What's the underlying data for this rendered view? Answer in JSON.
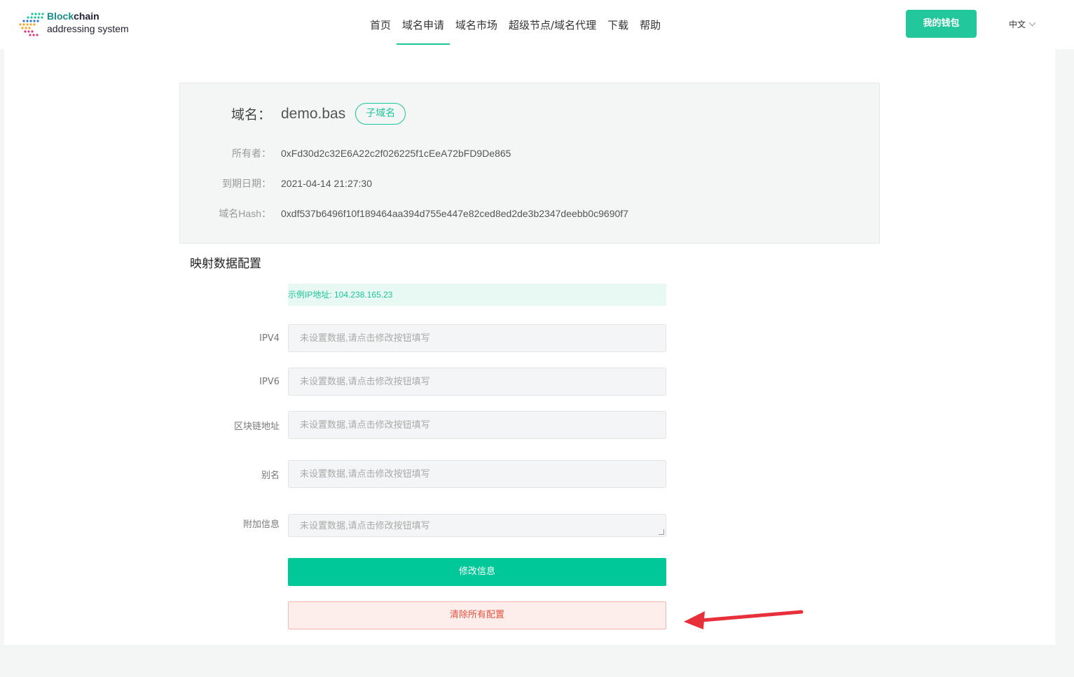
{
  "header": {
    "logo": {
      "line1_a": "Block",
      "line1_b": "chain",
      "line2": "addressing system"
    },
    "nav": [
      {
        "label": "首页",
        "active": false
      },
      {
        "label": "域名申请",
        "active": true
      },
      {
        "label": "域名市场",
        "active": false
      },
      {
        "label": "超级节点/域名代理",
        "active": false
      },
      {
        "label": "下载",
        "active": false
      },
      {
        "label": "帮助",
        "active": false
      }
    ],
    "wallet_button": "我的钱包",
    "language": "中文"
  },
  "domain_info": {
    "domain_label": "域名：",
    "domain_value": "demo.bas",
    "domain_tag": "子域名",
    "owner_label": "所有者：",
    "owner_value": "0xFd30d2c32E6A22c2f026225f1cEeA72bFD9De865",
    "expiry_label": "到期日期：",
    "expiry_value": "2021-04-14 21:27:30",
    "hash_label": "域名Hash：",
    "hash_value": "0xdf537b6496f10f189464aa394d755e447e82ced8ed2de3b2347deebb0c9690f7"
  },
  "mapping": {
    "title": "映射数据配置",
    "hint": "示例IP地址: 104.238.165.23",
    "fields": [
      {
        "label": "IPV4",
        "placeholder": "未设置数据,请点击修改按钮填写"
      },
      {
        "label": "IPV6",
        "placeholder": "未设置数据,请点击修改按钮填写"
      },
      {
        "label": "区块链地址",
        "placeholder": "未设置数据,请点击修改按钮填写"
      },
      {
        "label": "别名",
        "placeholder": "未设置数据,请点击修改按钮填写"
      },
      {
        "label": "附加信息",
        "placeholder": "未设置数据,请点击修改按钮填写"
      }
    ],
    "edit_button": "修改信息",
    "clear_button": "清除所有配置"
  },
  "colors": {
    "accent": "#1cc69a",
    "button_green": "#00c898",
    "danger": "#e8513d",
    "arrow": "#e8303a"
  }
}
